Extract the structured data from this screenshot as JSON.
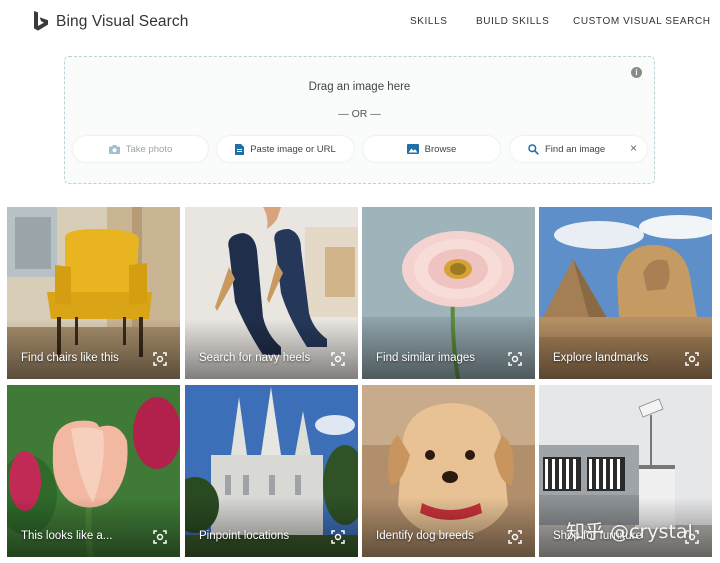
{
  "header": {
    "brand": "Bing Visual Search",
    "nav": [
      "SKILLS",
      "BUILD SKILLS",
      "CUSTOM VISUAL SEARCH"
    ]
  },
  "dropzone": {
    "drag_text": "Drag an image here",
    "or_text": "— OR —",
    "info_symbol": "i",
    "buttons": {
      "take_photo": "Take photo",
      "paste": "Paste image or URL",
      "browse": "Browse",
      "find": "Find an image",
      "close_symbol": "×"
    }
  },
  "tiles": [
    {
      "caption": "Find chairs like this",
      "scene": "yellow-chair"
    },
    {
      "caption": "Search for navy heels",
      "scene": "navy-heels"
    },
    {
      "caption": "Find similar images",
      "scene": "pink-flower"
    },
    {
      "caption": "Explore landmarks",
      "scene": "sphinx-pyramid"
    },
    {
      "caption": "This looks like a...",
      "scene": "tulip"
    },
    {
      "caption": "Pinpoint locations",
      "scene": "temple"
    },
    {
      "caption": "Identify dog breeds",
      "scene": "puppy"
    },
    {
      "caption": "Shop for furniture",
      "scene": "sofa"
    }
  ],
  "watermark": "知乎 @crystal",
  "colors": {
    "accent": "#0078d4",
    "dashed_border": "#b9d3d8"
  }
}
